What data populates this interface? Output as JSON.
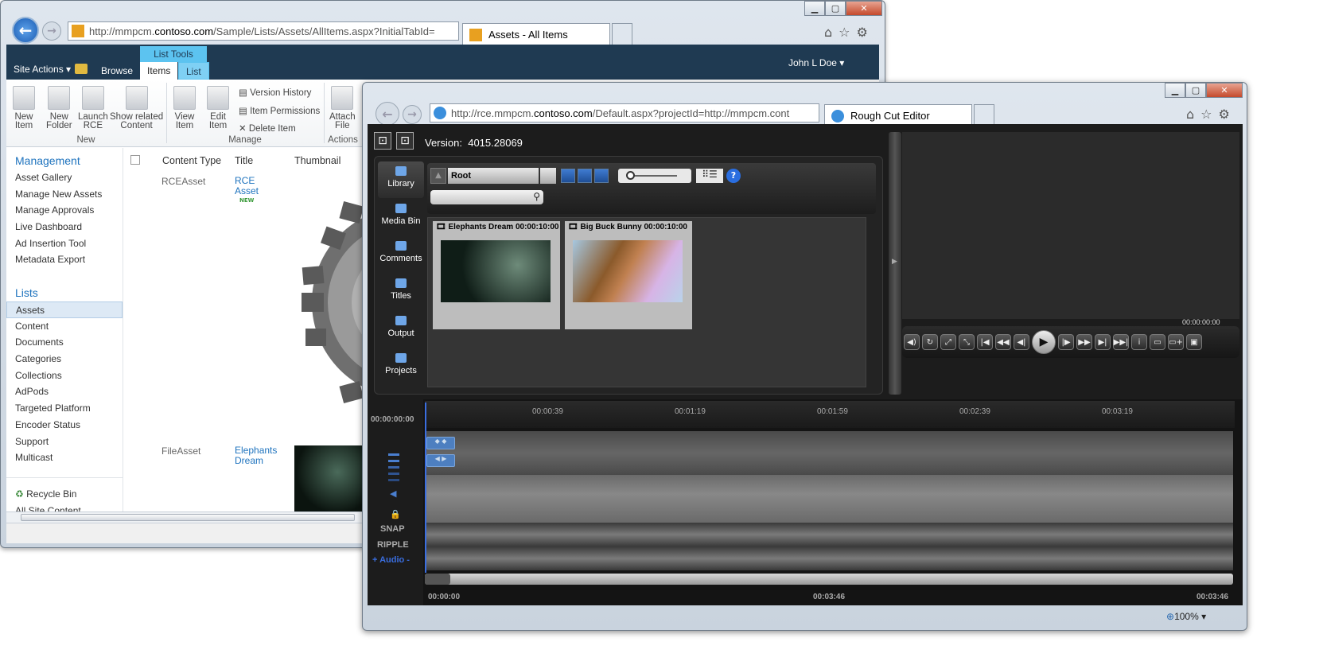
{
  "sharepoint_window": {
    "url_domain": "contoso.com",
    "url_prefix": "http://mmpcm.",
    "url_suffix": "/Sample/Lists/Assets/AllItems.aspx?InitialTabId=",
    "tab_title": "Assets - All Items",
    "ribbon": {
      "site_actions": "Site Actions",
      "browse": "Browse",
      "list_tools": "List Tools",
      "items": "Items",
      "list": "List",
      "user": "John L Doe"
    },
    "buttons": {
      "new_item": "New",
      "new_item2": "Item",
      "new_folder": "New",
      "new_folder2": "Folder",
      "launch_rce": "Launch",
      "launch_rce2": "RCE",
      "show_related": "Show related",
      "show_related2": "Content",
      "view_item": "View",
      "view_item2": "Item",
      "edit_item": "Edit",
      "edit_item2": "Item",
      "version_history": "Version History",
      "item_permissions": "Item Permissions",
      "delete_item": "Delete Item",
      "attach_file": "Attach",
      "attach_file2": "File"
    },
    "groups": {
      "new": "New",
      "manage": "Manage",
      "actions": "Actions"
    },
    "quicklaunch": {
      "management": "Management",
      "management_items": [
        "Asset Gallery",
        "Manage New Assets",
        "Manage Approvals",
        "Live Dashboard",
        "Ad Insertion Tool",
        "Metadata Export"
      ],
      "lists": "Lists",
      "lists_items": [
        "Assets",
        "Content",
        "Documents",
        "Categories",
        "Collections",
        "AdPods",
        "Targeted Platform",
        "Encoder Status",
        "Support",
        "Multicast"
      ],
      "recycle_bin": "Recycle Bin",
      "all_site_content": "All Site Content"
    },
    "table": {
      "col_content_type": "Content Type",
      "col_title": "Title",
      "col_thumbnail": "Thumbnail",
      "rows": [
        {
          "type": "RCEAsset",
          "title1": "RCE",
          "title2": "Asset",
          "badge": "NEW"
        },
        {
          "type": "FileAsset",
          "title1": "Elephants",
          "title2": "Dream"
        }
      ]
    }
  },
  "rce_window": {
    "url_domain": "contoso.com",
    "url_prefix": "http://rce.mmpcm.",
    "url_suffix": "/Default.aspx?projectId=http://mmpcm.cont",
    "tab_title": "Rough Cut Editor",
    "version_label": "Version:",
    "version": "4015.28069",
    "sidebar": [
      "Library",
      "Media Bin",
      "Comments",
      "Titles",
      "Output",
      "Projects"
    ],
    "library": {
      "folder": "Root",
      "search_placeholder": "",
      "items": [
        {
          "name": "Elephants Dream",
          "duration": "00:00:10:00"
        },
        {
          "name": "Big Buck Bunny",
          "duration": "00:00:10:00"
        }
      ]
    },
    "player": {
      "timecode": "00:00:00:00"
    },
    "timeline": {
      "current": "00:00:00:00",
      "ruler": [
        "00:00:39",
        "00:01:19",
        "00:01:59",
        "00:02:39",
        "00:03:19"
      ],
      "start": "00:00:00",
      "middle": "00:03:46",
      "end": "00:03:46",
      "snap": "SNAP",
      "ripple": "RIPPLE",
      "audio": "+ Audio -"
    },
    "zoom": "100%"
  }
}
